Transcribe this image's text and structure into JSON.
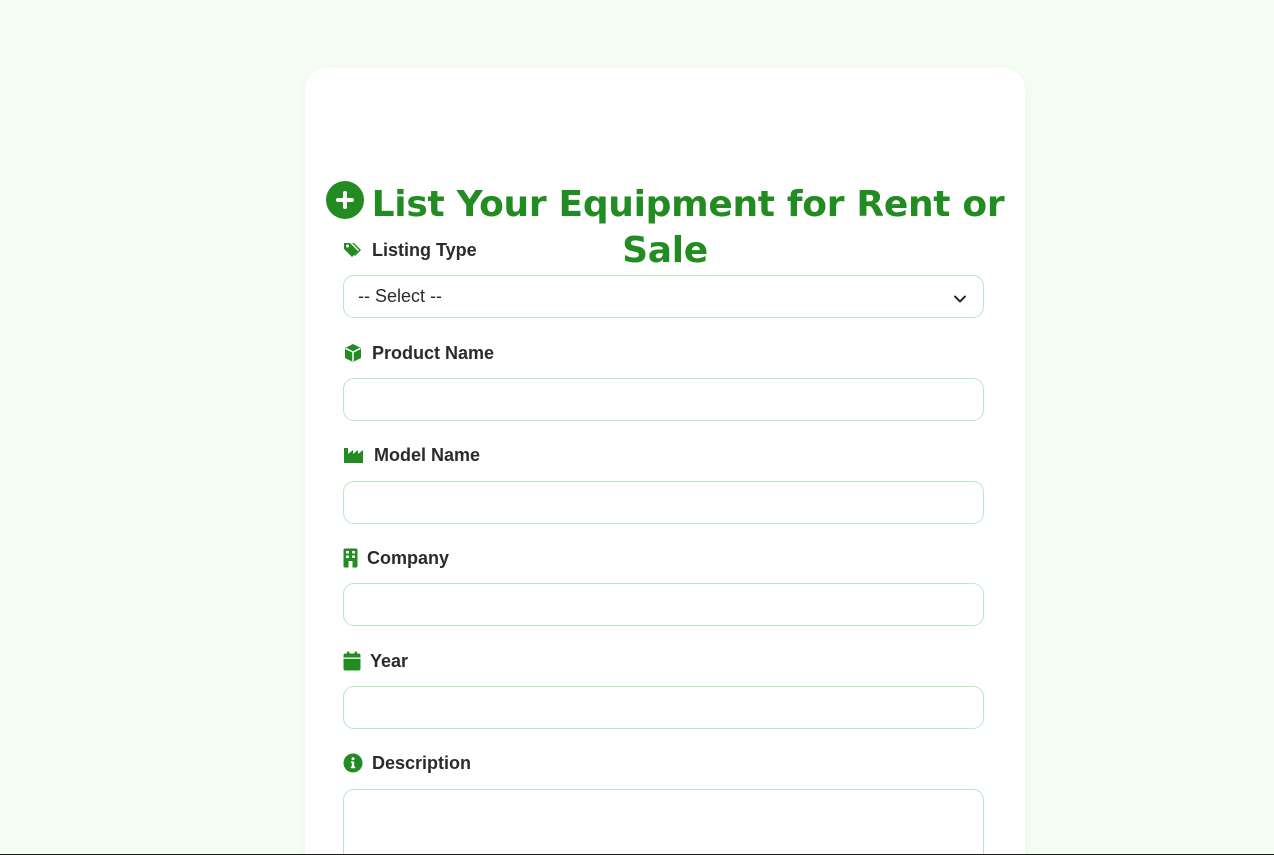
{
  "form": {
    "title": "List Your Equipment for Rent or Sale",
    "title_icon": "plus-circle-icon",
    "accent_color": "#228b22",
    "border_color": "#b5ecc0",
    "fields": {
      "listing_type": {
        "label": "Listing Type",
        "icon": "tags-icon",
        "selected": "-- Select --"
      },
      "product_name": {
        "label": "Product Name",
        "icon": "cube-icon",
        "value": ""
      },
      "model_name": {
        "label": "Model Name",
        "icon": "industry-icon",
        "value": ""
      },
      "company": {
        "label": "Company",
        "icon": "building-icon",
        "value": ""
      },
      "year": {
        "label": "Year",
        "icon": "calendar-icon",
        "value": ""
      },
      "description": {
        "label": "Description",
        "icon": "info-circle-icon",
        "value": ""
      }
    }
  }
}
